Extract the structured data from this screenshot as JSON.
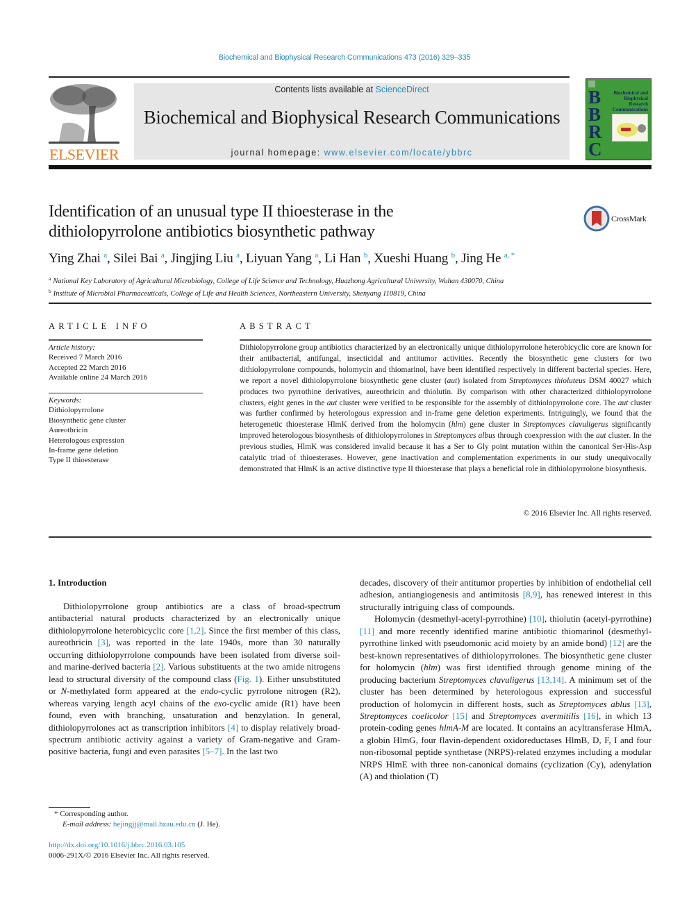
{
  "header": {
    "citation": "Biochemical and Biophysical Research Communications 473 (2016) 329–335",
    "contents_prefix": "Contents lists available at ",
    "contents_link": "ScienceDirect",
    "journal_name": "Biochemical and Biophysical Research Communications",
    "homepage_prefix": "journal homepage: ",
    "homepage_link": "www.elsevier.com/locate/ybbrc",
    "publisher_logo": "ELSEVIER",
    "cover": {
      "letters": [
        "B",
        "B",
        "R",
        "C"
      ],
      "title_lines": [
        "Biochemical and",
        "Biophysical",
        "Research",
        "Communications"
      ]
    },
    "crossmark_label": "CrossMark",
    "colors": {
      "link": "#2a8ab8",
      "elsevier_orange": "#f07c1e",
      "cover_green": "#3f9a3a",
      "header_gray": "#e6e6e6"
    }
  },
  "article": {
    "title_line1": "Identification of an unusual type II thioesterase in the",
    "title_line2": "dithiolopyrrolone antibiotics biosynthetic pathway",
    "authors": [
      {
        "name": "Ying Zhai",
        "sup": "a"
      },
      {
        "name": "Silei Bai",
        "sup": "a"
      },
      {
        "name": "Jingjing Liu",
        "sup": "a"
      },
      {
        "name": "Liyuan Yang",
        "sup": "a"
      },
      {
        "name": "Li Han",
        "sup": "b"
      },
      {
        "name": "Xueshi Huang",
        "sup": "b"
      },
      {
        "name": "Jing He",
        "sup": "a, *"
      }
    ],
    "affiliations": [
      {
        "mark": "a",
        "text": "National Key Laboratory of Agricultural Microbiology, College of Life Science and Technology, Huazhong Agricultural University, Wuhan 430070, China"
      },
      {
        "mark": "b",
        "text": "Institute of Microbial Pharmaceuticals, College of Life and Health Sciences, Northeastern University, Shenyang 110819, China"
      }
    ]
  },
  "article_info": {
    "heading": "ARTICLE INFO",
    "history_label": "Article history:",
    "history": [
      "Received 7 March 2016",
      "Accepted 22 March 2016",
      "Available online 24 March 2016"
    ],
    "keywords_label": "Keywords:",
    "keywords": [
      "Dithiolopyrrolone",
      "Biosynthetic gene cluster",
      "Aureothricin",
      "Heterologous expression",
      "In-frame gene deletion",
      "Type II thioesterase"
    ]
  },
  "abstract": {
    "heading": "ABSTRACT",
    "parts": [
      {
        "t": "Dithiolopyrrolone group antibiotics characterized by an electronically unique dithiolopyrrolone heter­obicyclic core are known for their antibacterial, antifungal, insecticidal and antitumor activities. Recently the biosynthetic gene clusters for two dithiolopyrrolone compounds, holomycin and thiomarinol, have been identified respectively in different bacterial species. Here, we report a novel dithiolopyrrolone biosynthetic gene cluster ("
      },
      {
        "t": "aut",
        "i": true
      },
      {
        "t": ") isolated from "
      },
      {
        "t": "Streptomyces thioluteus",
        "i": true
      },
      {
        "t": " DSM 40027 which produces two pyrrothine derivatives, aureothricin and thiolutin. By comparison with other characterized dithiolo­pyrrolone clusters, eight genes in the "
      },
      {
        "t": "aut",
        "i": true
      },
      {
        "t": " cluster were verified to be responsible for the assembly of dithiolopyrrolone core. The "
      },
      {
        "t": "aut",
        "i": true
      },
      {
        "t": " cluster was further confirmed by heterologous expression and in-frame gene deletion experiments. Intriguingly, we found that the heterogenetic thioesterase HlmK derived from the holomycin ("
      },
      {
        "t": "hlm",
        "i": true
      },
      {
        "t": ") gene cluster in "
      },
      {
        "t": "Streptomyces clavuligerus",
        "i": true
      },
      {
        "t": " significantly improved heterologous biosynthesis of dithiolopyrrolones in "
      },
      {
        "t": "Streptomyces albus",
        "i": true
      },
      {
        "t": " through coexpression with the "
      },
      {
        "t": "aut",
        "i": true
      },
      {
        "t": " cluster. In the previous studies, HlmK was considered invalid because it has a Ser to Gly point mutation within the canonical Ser-His-Asp catalytic triad of thioesterases. However, gene inactivation and complementation experiments in our study unequivocally demonstrated that HlmK is an active distinctive type II thio­esterase that plays a beneficial role in dithiolopyrrolone biosynthesis."
      }
    ],
    "copyright": "© 2016 Elsevier Inc. All rights reserved."
  },
  "introduction": {
    "heading": "1.  Introduction",
    "left_column": [
      {
        "t": "Dithiolopyrrolone group antibiotics are a class of broad-spectrum antibacterial natural products characterized by an elec­tronically unique dithiolopyrrolone heterobicyclic core "
      },
      {
        "t": "[1,2]",
        "l": true
      },
      {
        "t": ". Since the first member of this class, aureothricin "
      },
      {
        "t": "[3]",
        "l": true
      },
      {
        "t": ", was reported in the late 1940s, more than 30 naturally occurring dithiolopyrrolone compounds have been isolated from diverse soil- and marine-derived bacteria "
      },
      {
        "t": "[2]",
        "l": true
      },
      {
        "t": ". Various substituents at the two amide nitro­gens lead to structural diversity of the compound class ("
      },
      {
        "t": "Fig. 1",
        "l": true
      },
      {
        "t": "). Either unsubstituted or "
      },
      {
        "t": "N",
        "i": true
      },
      {
        "t": "-methylated form appeared at the "
      },
      {
        "t": "endo",
        "i": true
      },
      {
        "t": "-cyclic pyrrolone nitrogen (R2), whereas varying length acyl chains of the "
      },
      {
        "t": "exo",
        "i": true
      },
      {
        "t": "-cyclic amide (R1) have been found, even with branching, unsaturation and benzylation. In general, dithiolopyrrolones act as transcription inhibitors "
      },
      {
        "t": "[4]",
        "l": true
      },
      {
        "t": " to display relatively broad-spectrum antibiotic activity against a variety of Gram-negative and Gram-positive bacteria, fungi and even parasites "
      },
      {
        "t": "[5–7]",
        "l": true
      },
      {
        "t": ". In the last two"
      }
    ],
    "right_para1": [
      {
        "t": "decades, discovery of their antitumor properties by inhibition of endothelial cell adhesion, antiangiogenesis and antimitosis "
      },
      {
        "t": "[8,9]",
        "l": true
      },
      {
        "t": ", has renewed interest in this structurally intriguing class of compounds."
      }
    ],
    "right_para2": [
      {
        "t": "Holomycin (desmethyl-acetyl-pyrrothine) "
      },
      {
        "t": "[10]",
        "l": true
      },
      {
        "t": ", thiolutin (acetyl-pyrrothine) "
      },
      {
        "t": "[11]",
        "l": true
      },
      {
        "t": " and more recently identified marine anti­biotic thiomarinol (desmethyl-pyrrothine linked with pseudo­monic acid moiety by an amide bond) "
      },
      {
        "t": "[12]",
        "l": true
      },
      {
        "t": " are the best-known representatives of dithiolopyrrolones. The biosynthetic gene cluster for holomycin ("
      },
      {
        "t": "hlm",
        "i": true
      },
      {
        "t": ") was first identified through genome mining of the producing bacterium "
      },
      {
        "t": "Streptomyces clavuligerus",
        "i": true
      },
      {
        "t": " "
      },
      {
        "t": "[13,14]",
        "l": true
      },
      {
        "t": ". A min­imum set of the cluster has been determined by heterologous expression and successful production of holomycin in different hosts, such as "
      },
      {
        "t": "Streptomyces ablus",
        "i": true
      },
      {
        "t": " "
      },
      {
        "t": "[13]",
        "l": true
      },
      {
        "t": ", "
      },
      {
        "t": "Streptomyces coelicolor",
        "i": true
      },
      {
        "t": " "
      },
      {
        "t": "[15]",
        "l": true
      },
      {
        "t": " and "
      },
      {
        "t": "Streptomyces avermitilis",
        "i": true
      },
      {
        "t": " "
      },
      {
        "t": "[16]",
        "l": true
      },
      {
        "t": ", in which 13 protein-coding genes "
      },
      {
        "t": "hlmA-M",
        "i": true
      },
      {
        "t": " are located. It contains an acyltransferase HlmA, a globin HlmG, four flavin-dependent oxidoreductases HlmB, D, F, I and four non-ribosomal peptide synthetase (NRPS)-related en­zymes including a modular NRPS HlmE with three non-canonical domains (cyclization (Cy), adenylation (A) and thiolation (T)"
      }
    ]
  },
  "footnotes": {
    "corresponding": "* Corresponding author.",
    "email_label": "E-mail address: ",
    "email": "hejingjj@mail.hzau.edu.cn",
    "email_suffix": " (J. He).",
    "doi": "http://dx.doi.org/10.1016/j.bbrc.2016.03.105",
    "issn": "0006-291X/© 2016 Elsevier Inc. All rights reserved."
  }
}
